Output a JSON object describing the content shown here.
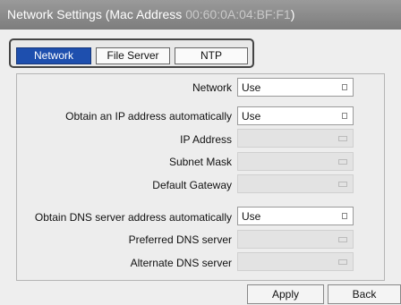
{
  "window": {
    "title": "Network Settings (Mac Address",
    "mac_address": "00:60:0A:04:BF:F1",
    "title_suffix": ")"
  },
  "tabs": [
    {
      "label": "Network",
      "active": true
    },
    {
      "label": "File Server",
      "active": false
    },
    {
      "label": "NTP",
      "active": false
    }
  ],
  "form": {
    "network": {
      "label": "Network",
      "value": "Use"
    },
    "obtain_ip": {
      "label": "Obtain an IP address automatically",
      "value": "Use"
    },
    "ip_address": {
      "label": "IP Address",
      "value": ""
    },
    "subnet_mask": {
      "label": "Subnet Mask",
      "value": ""
    },
    "default_gateway": {
      "label": "Default Gateway",
      "value": ""
    },
    "obtain_dns": {
      "label": "Obtain DNS server address automatically",
      "value": "Use"
    },
    "preferred_dns": {
      "label": "Preferred DNS server",
      "value": ""
    },
    "alternate_dns": {
      "label": "Alternate DNS server",
      "value": ""
    }
  },
  "buttons": {
    "apply": "Apply",
    "back": "Back"
  },
  "colors": {
    "titlebar": "#8a8a8a",
    "active_tab": "#1e4fae",
    "background": "#eeeeee"
  }
}
